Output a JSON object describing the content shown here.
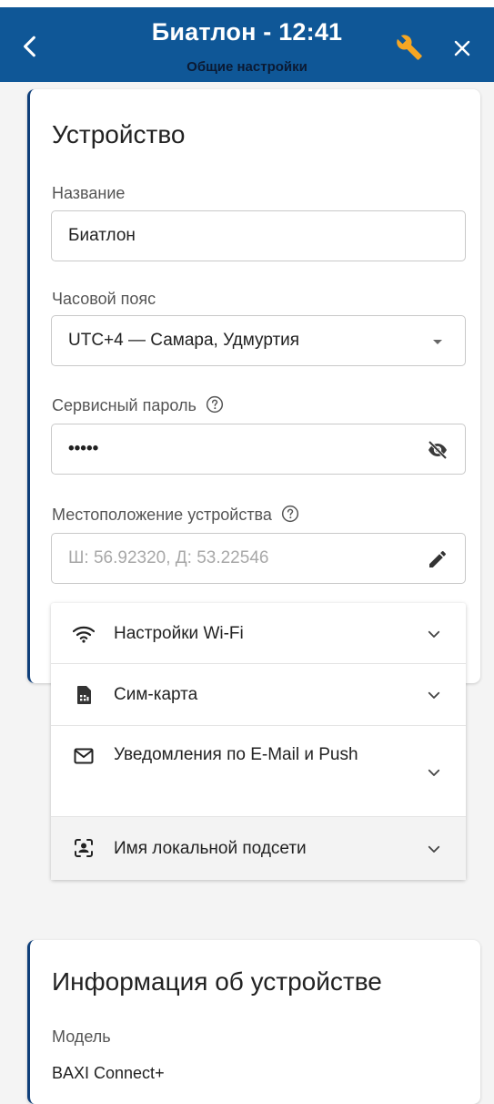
{
  "header": {
    "title": "Биатлон - 12:41",
    "subtitle": "Общие настройки",
    "colors": {
      "bar": "#0f5797",
      "wrench": "#f5a623"
    }
  },
  "device": {
    "section_title": "Устройство",
    "name_label": "Название",
    "name_value": "Биатлон",
    "timezone_label": "Часовой пояс",
    "timezone_value": "UTC+4 — Самара, Удмуртия",
    "password_label": "Сервисный пароль",
    "password_value": "•••••",
    "location_label": "Местоположение устройства",
    "location_placeholder": "Ш: 56.92320, Д: 53.22546"
  },
  "accordion": [
    {
      "icon": "wifi-icon",
      "label": "Настройки Wi-Fi"
    },
    {
      "icon": "sim-card-icon",
      "label": "Сим-карта"
    },
    {
      "icon": "mail-icon",
      "label": "Уведомления по E-Mail и Push"
    },
    {
      "icon": "local-network-icon",
      "label": "Имя локальной подсети"
    }
  ],
  "info": {
    "section_title": "Информация об устройстве",
    "model_label": "Модель",
    "model_value": "BAXI Connect+"
  }
}
